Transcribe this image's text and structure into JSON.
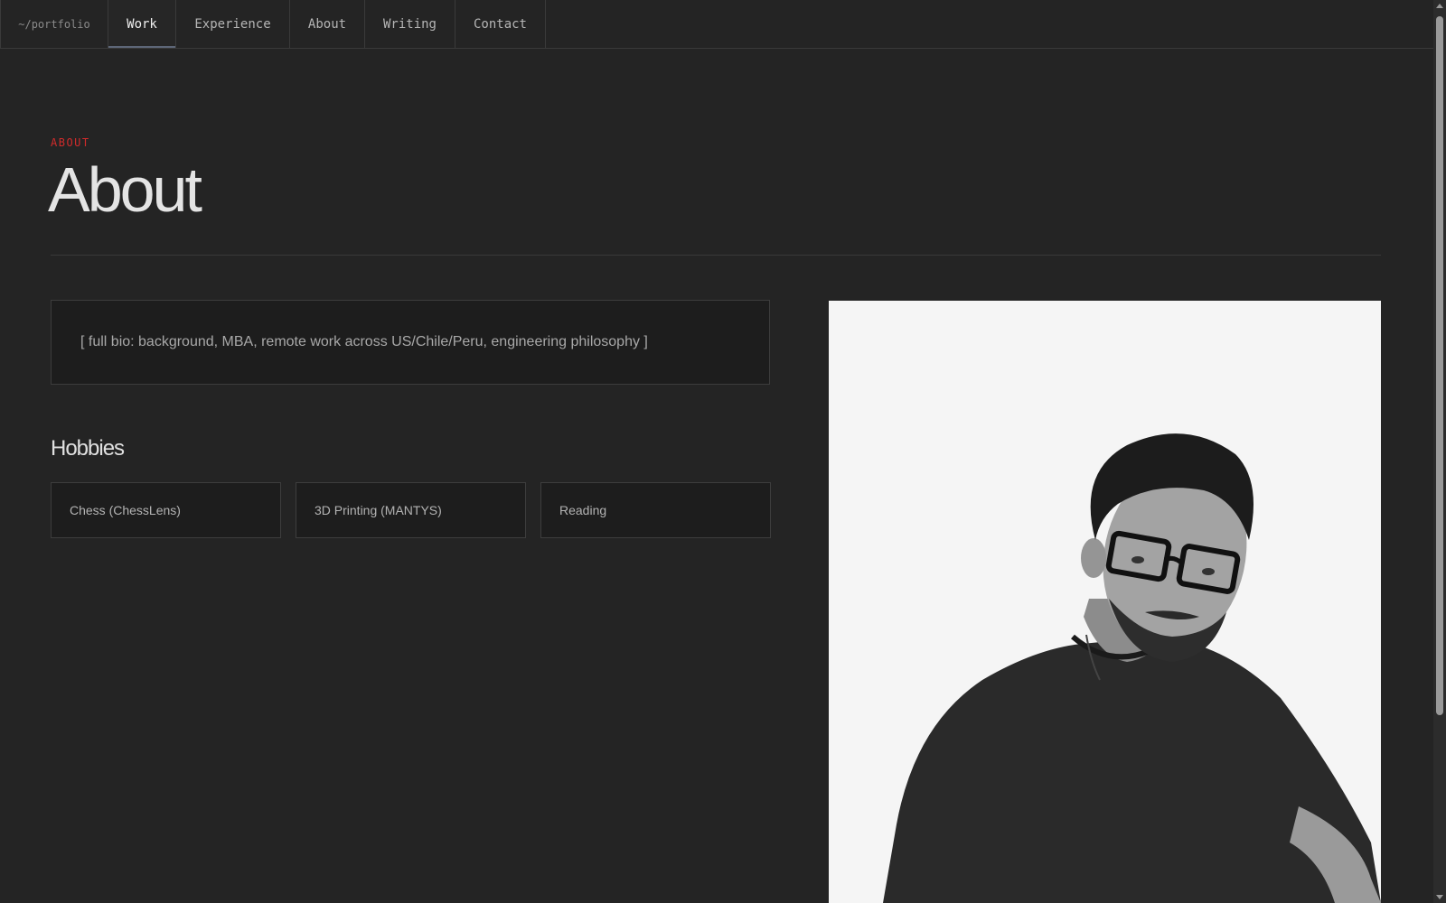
{
  "nav": {
    "home": "~/portfolio",
    "tabs": [
      {
        "label": "Work",
        "active": true
      },
      {
        "label": "Experience",
        "active": false
      },
      {
        "label": "About",
        "active": false
      },
      {
        "label": "Writing",
        "active": false
      },
      {
        "label": "Contact",
        "active": false
      }
    ]
  },
  "section": {
    "eyebrow": "ABOUT",
    "title": "About"
  },
  "bio": {
    "placeholder": "[ full bio: background, MBA, remote work across US/Chile/Peru, engineering philosophy ]"
  },
  "hobbies": {
    "title": "Hobbies",
    "items": [
      "Chess (ChessLens)",
      "3D Printing (MANTYS)",
      "Reading"
    ]
  },
  "colors": {
    "background": "#242424",
    "accent": "#d12b2b",
    "card": "#1d1d1d",
    "photo_background": "#f5f5f5"
  }
}
